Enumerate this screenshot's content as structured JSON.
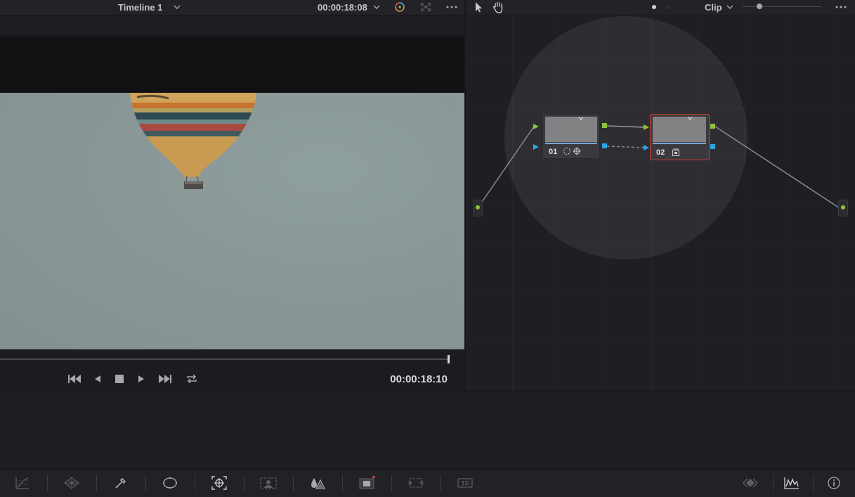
{
  "viewer": {
    "timeline_name": "Timeline 1",
    "header_timecode": "00:00:18:08",
    "current_timecode": "00:00:18:10",
    "playhead_progress": 0.965
  },
  "node_editor": {
    "mode_label": "Clip",
    "nodes": [
      {
        "label": "01",
        "selected": false
      },
      {
        "label": "02",
        "selected": true
      }
    ]
  },
  "icons": {
    "viewer_header": [
      "chevron-down-icon",
      "color-wheel-icon",
      "fullscreen-icon",
      "more-options-icon"
    ],
    "transport": [
      "go-to-start-icon",
      "play-reverse-icon",
      "stop-icon",
      "play-icon",
      "go-to-end-icon",
      "loop-icon"
    ],
    "node_header": [
      "pointer-tool-icon",
      "hand-tool-icon",
      "more-options-icon"
    ],
    "bottom_toolbar": [
      "curves-icon",
      "color-warper-icon",
      "qualifier-icon",
      "window-icon",
      "tracker-icon",
      "magic-mask-icon",
      "blur-icon",
      "key-icon",
      "sizing-icon",
      "3d-icon",
      "keyframes-icon",
      "scopes-icon",
      "info-icon"
    ]
  },
  "colors": {
    "selected_node_outline": "#d03a32",
    "rgb_port": "#8fc43a",
    "key_port": "#2aa6e8",
    "node_line": "#7aa6d6"
  }
}
